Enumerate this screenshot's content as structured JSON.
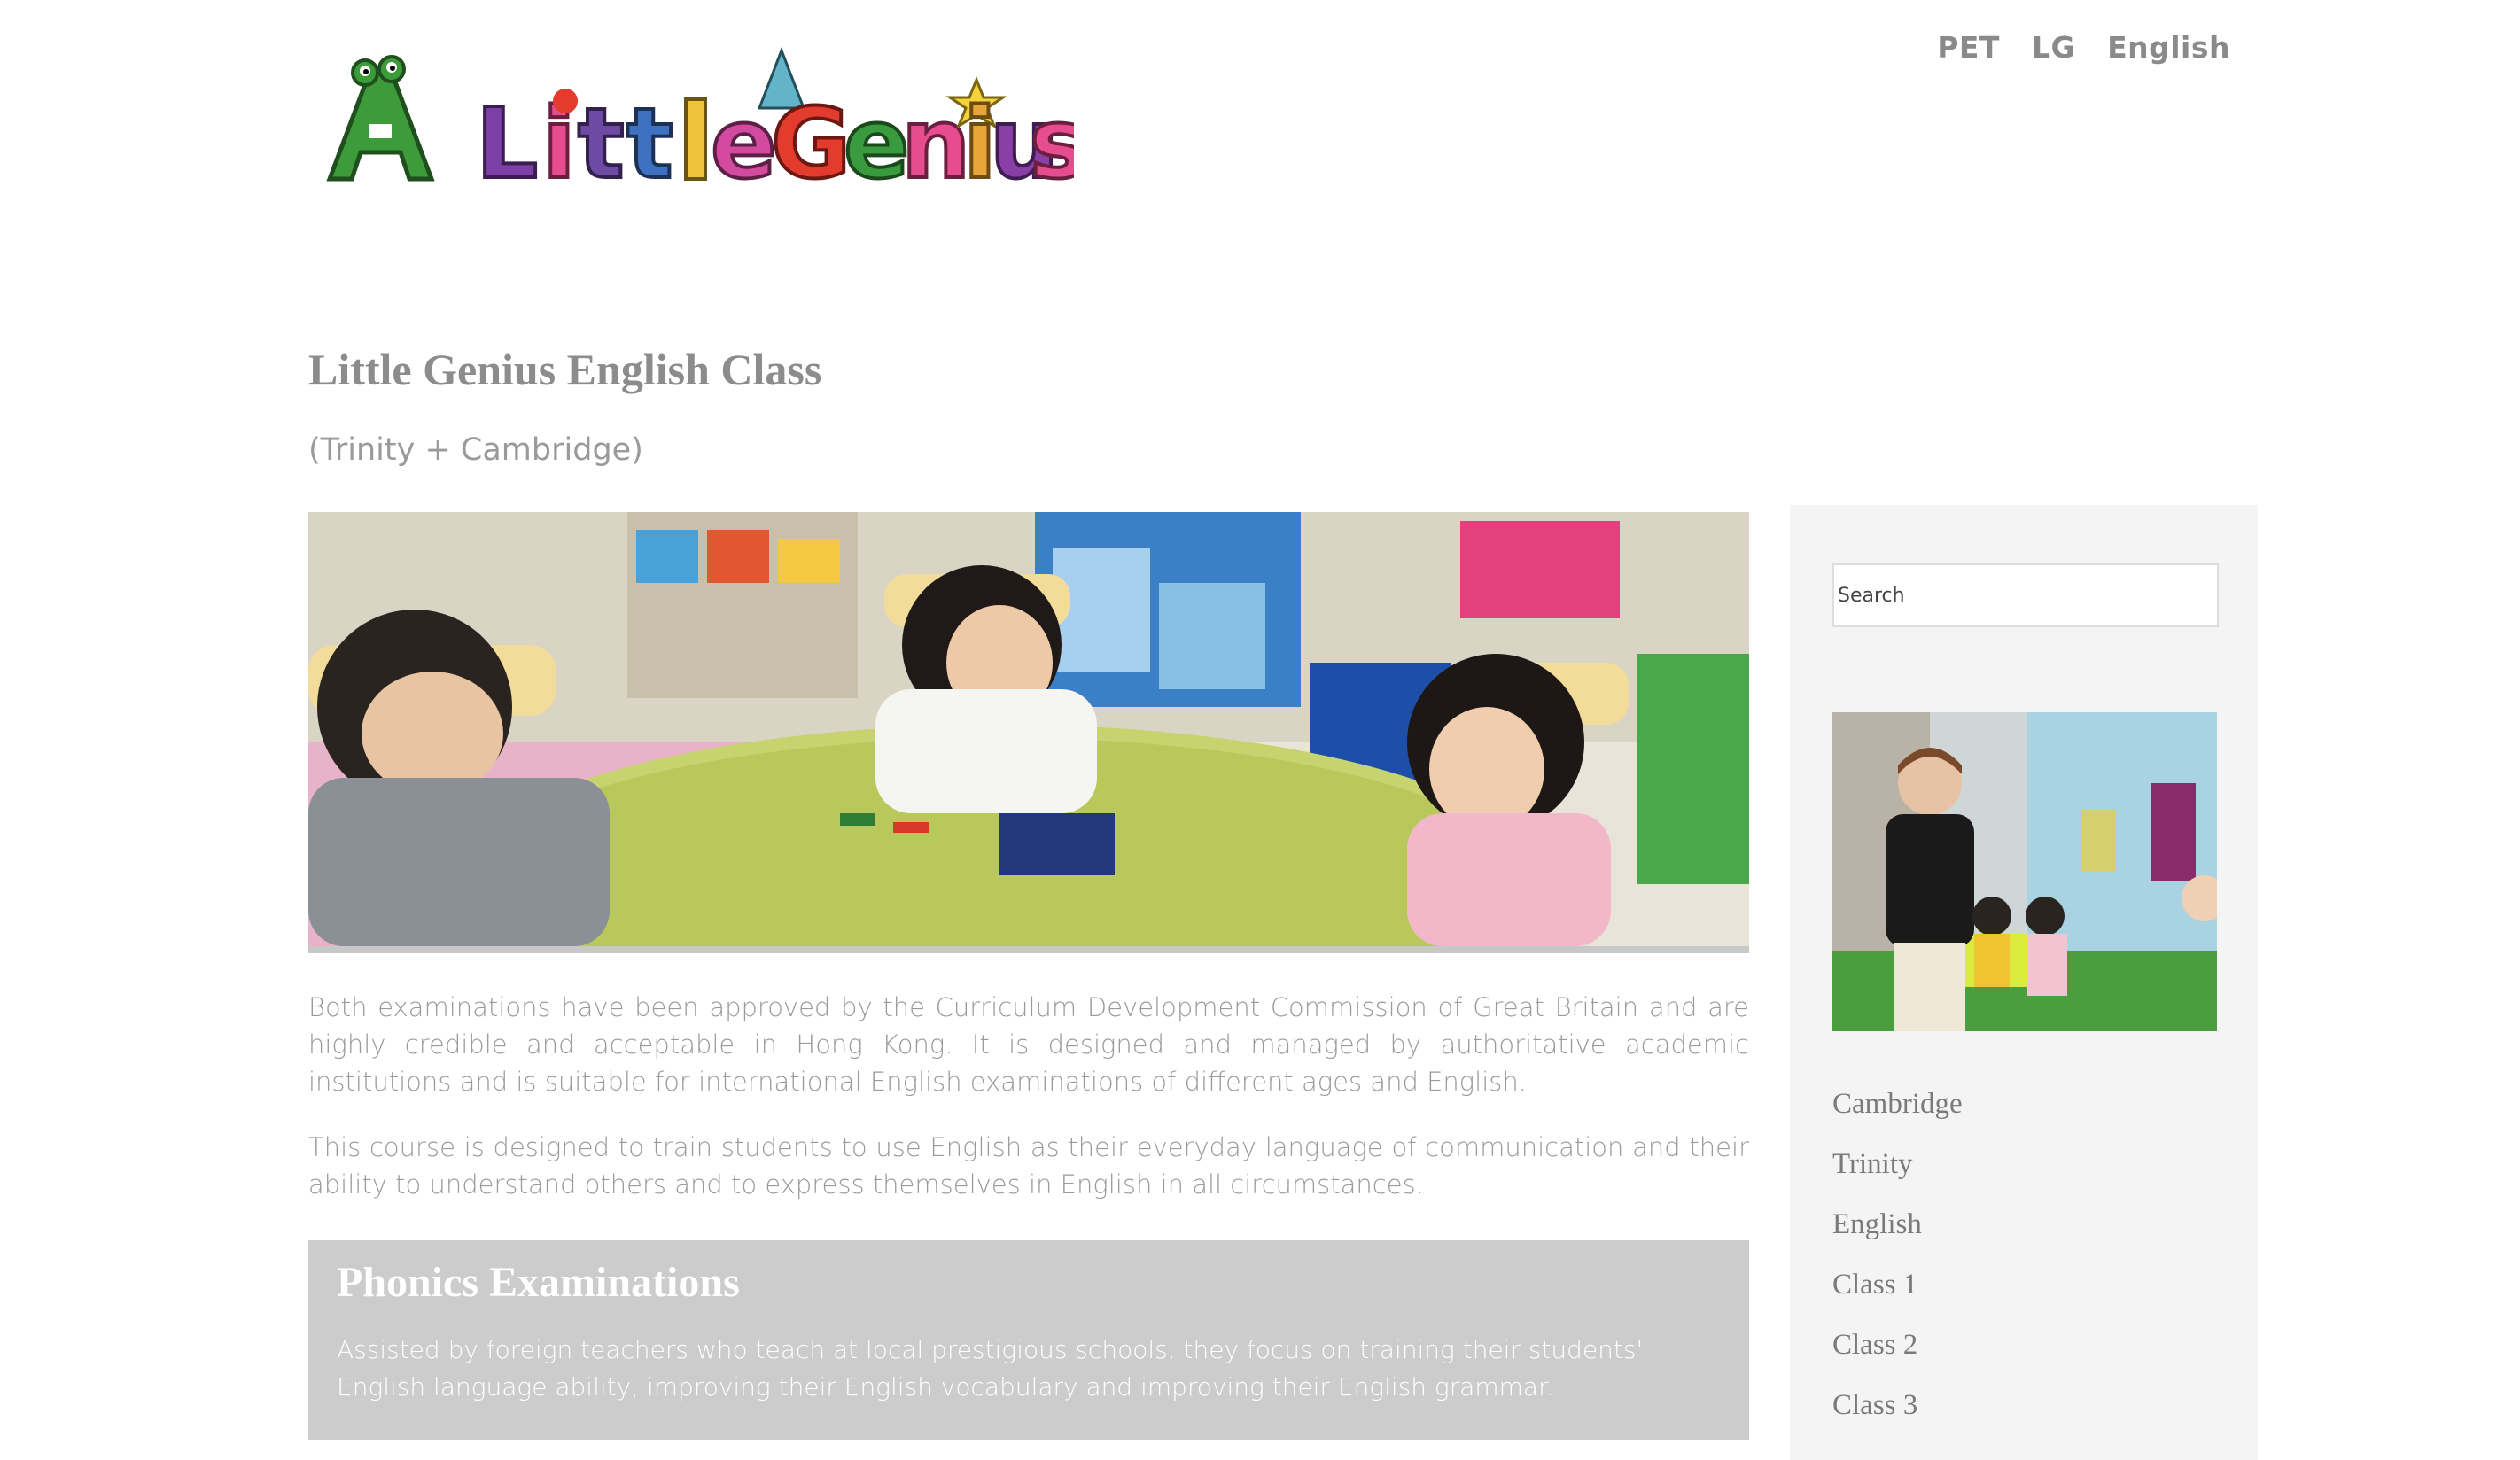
{
  "nav": {
    "items": [
      "PET",
      "LG",
      "English"
    ]
  },
  "logo": {
    "text": "A Little Genius"
  },
  "page": {
    "title": "Little Genius English Class",
    "subtitle": "(Trinity + Cambridge)"
  },
  "content": {
    "para1": "Both examinations have been approved by the Curriculum Development Commission of Great Britain and are highly credible and acceptable in Hong Kong. It is designed and managed by authoritative academic institutions and is suitable for international English examinations of different ages and English.",
    "para2": "This course is designed to train students to use English as their everyday language of communication and their ability to understand others and to express themselves in English in all circumstances."
  },
  "phonics": {
    "title": "Phonics Examinations",
    "text": "Assisted by foreign teachers who teach at local prestigious schools, they focus on training their students' English language ability, improving their English vocabulary and improving their English grammar."
  },
  "sidebar": {
    "search_placeholder": "Search",
    "menu": [
      "Cambridge",
      "Trinity",
      "English",
      "Class 1",
      "Class 2",
      "Class 3"
    ]
  },
  "colors": {
    "text_gray": "#888888",
    "phonics_bg": "#cccccc",
    "sidebar_bg": "#f4f4f4"
  }
}
